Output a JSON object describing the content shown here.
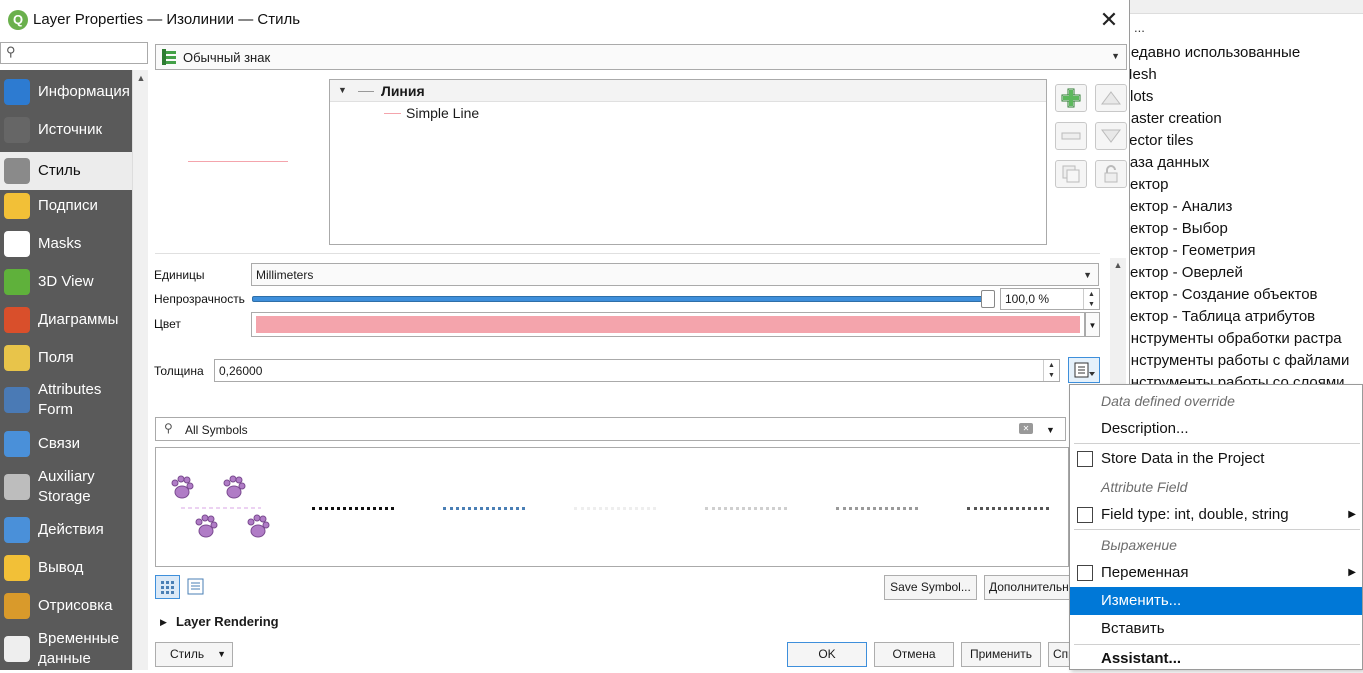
{
  "window": {
    "title": "Layer Properties — Изолинии — Стиль",
    "close": "✕"
  },
  "nav": {
    "search_icon": "search-icon",
    "items": [
      {
        "label": "Информация",
        "icon": "info-icon",
        "color": "#2d7bd1"
      },
      {
        "label": "Источник",
        "icon": "wrench-icon",
        "color": "#666666"
      },
      {
        "label": "Стиль",
        "icon": "paintbrush-icon",
        "color": "#8a8a8a"
      },
      {
        "label": "Подписи",
        "icon": "labels-abc-icon",
        "color": "#f2c037"
      },
      {
        "label": "Masks",
        "icon": "masks-abc-icon",
        "color": "#ffffff"
      },
      {
        "label": "3D View",
        "icon": "cube-icon",
        "color": "#5fb13b"
      },
      {
        "label": "Диаграммы",
        "icon": "diagram-icon",
        "color": "#d94f2b"
      },
      {
        "label": "Поля",
        "icon": "fields-icon",
        "color": "#e8c44a"
      },
      {
        "label": "Attributes Form",
        "icon": "form-icon",
        "color": "#4a7ab5"
      },
      {
        "label": "Связи",
        "icon": "relations-icon",
        "color": "#4a90d9"
      },
      {
        "label": "Auxiliary Storage",
        "icon": "database-icon",
        "color": "#bdbdbd"
      },
      {
        "label": "Действия",
        "icon": "actions-gear-icon",
        "color": "#4a90d9"
      },
      {
        "label": "Вывод",
        "icon": "display-bubble-icon",
        "color": "#f2c037"
      },
      {
        "label": "Отрисовка",
        "icon": "rendering-brush-icon",
        "color": "#d99a2b"
      },
      {
        "label": "Временные данные",
        "icon": "clock-icon",
        "color": "#eeeeee"
      }
    ]
  },
  "style": {
    "renderer": "Обычный знак",
    "tree": {
      "root": "Линия",
      "child": "Simple Line"
    },
    "units_label": "Единицы",
    "units_value": "Millimeters",
    "opacity_label": "Непрозрачность",
    "opacity_value": "100,0 %",
    "opacity_fraction": 1.0,
    "color_label": "Цвет",
    "color_value": "#f4a4ac",
    "width_label": "Толщина",
    "width_value": "0,26000",
    "symbol_search": "All Symbols",
    "save_symbol": "Save Symbol...",
    "advanced": "Дополнительно",
    "layer_rendering": "Layer Rendering"
  },
  "footer": {
    "style_btn": "Стиль",
    "ok": "OK",
    "cancel": "Отмена",
    "apply": "Применить",
    "help": "Справка"
  },
  "context_menu": {
    "dd_header": "Data defined override",
    "description": "Description...",
    "store_data": "Store Data in the Project",
    "attr_header": "Attribute Field",
    "field_type": "Field type: int, double, string",
    "expr_header": "Выражение",
    "variable": "Переменная",
    "edit": "Изменить...",
    "paste": "Вставить",
    "assistant": "Assistant..."
  },
  "background": {
    "search": "...",
    "items": [
      "Недавно использованные",
      "Mesh",
      "Plots",
      "Raster creation",
      "Vector tiles",
      "База данных",
      "Вектор",
      "Вектор - Анализ",
      "Вектор - Выбор",
      "Вектор - Геометрия",
      "Вектор - Оверлей",
      "Вектор - Создание объектов",
      "Вектор - Таблица атрибутов",
      "Инструменты обработки растра",
      "Инструменты работы с файлами",
      "Инструменты работы со слоями"
    ]
  }
}
